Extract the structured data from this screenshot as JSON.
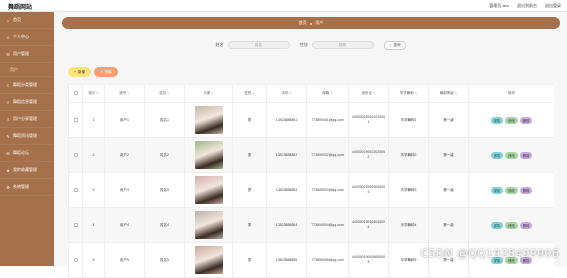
{
  "header": {
    "brand": "舞蹈网站",
    "links": [
      "管理员 abo",
      "退出到前台",
      "退出登录"
    ]
  },
  "sidebar": {
    "items": [
      {
        "label": "首页",
        "icon": "home-icon"
      },
      {
        "label": "个人中心",
        "icon": "person-icon"
      },
      {
        "label": "用户管理",
        "icon": "users-icon"
      },
      {
        "label": "用户",
        "icon": "",
        "sub": true
      },
      {
        "label": "舞蹈分类管理",
        "icon": "list-icon"
      },
      {
        "label": "舞蹈信息管理",
        "icon": "list-icon"
      },
      {
        "label": "用户分享管理",
        "icon": "share-icon"
      },
      {
        "label": "舞蹈资讯管理",
        "icon": "news-icon"
      },
      {
        "label": "舞蹈论坛",
        "icon": "chat-icon"
      },
      {
        "label": "我的收藏管理",
        "icon": "star-icon"
      },
      {
        "label": "系统管理",
        "icon": "gear-icon"
      }
    ]
  },
  "breadcrumb": {
    "home": "首页",
    "current": "用户"
  },
  "search": {
    "name_label": "姓名",
    "name_placeholder": "姓名",
    "gender_label": "性别",
    "gender_placeholder": "性别",
    "button": "查询"
  },
  "actions": {
    "add": "新增",
    "delete": "删除"
  },
  "table": {
    "columns": [
      "",
      "索引",
      "账号",
      "姓名",
      "头像",
      "性别",
      "手机",
      "邮箱",
      "身份证",
      "所学舞种",
      "舞蹈等级",
      "操作"
    ],
    "rows": [
      {
        "index": "1",
        "account": "用户1",
        "name": "姓名1",
        "gender": "男",
        "phone": "13823888881",
        "email": "773890001@qq.com",
        "id": "440300199101010001",
        "dance": "乐学舞种1",
        "level": "第一级",
        "photo_color": "#c9b8a8"
      },
      {
        "index": "2",
        "account": "用户2",
        "name": "姓名2",
        "gender": "男",
        "phone": "13823888882",
        "email": "773890002@qq.com",
        "id": "440300199102020002",
        "dance": "乐学舞种2",
        "level": "第一级",
        "photo_color": "#9fb88a"
      },
      {
        "index": "3",
        "account": "用户3",
        "name": "姓名3",
        "gender": "男",
        "phone": "13823888883",
        "email": "773890003@qq.com",
        "id": "440300199103030003",
        "dance": "乐学舞种3",
        "level": "第一级",
        "photo_color": "#d4aeb0"
      },
      {
        "index": "4",
        "account": "用户4",
        "name": "姓名4",
        "gender": "男",
        "phone": "13823888884",
        "email": "773890004@qq.com",
        "id": "440300199104040004",
        "dance": "乐学舞种4",
        "level": "第一级",
        "photo_color": "#b9b2ab"
      },
      {
        "index": "5",
        "account": "用户5",
        "name": "姓名5",
        "gender": "男",
        "phone": "13823888885",
        "email": "773890005@qq.com",
        "id": "440300199105050005",
        "dance": "乐学舞种5",
        "level": "第一级",
        "photo_color": "#c8a79a"
      }
    ],
    "ops": {
      "view": "详情",
      "edit": "修改",
      "delete": "删除"
    }
  },
  "watermark": "CSDN @QQ1928499906",
  "colors": {
    "sidebar": "#a6704a",
    "add": "#fbe37a",
    "delete": "#f7a06e",
    "view": "#7dd3d8",
    "edit": "#a7d6a3",
    "remove": "#c9a9e0"
  }
}
